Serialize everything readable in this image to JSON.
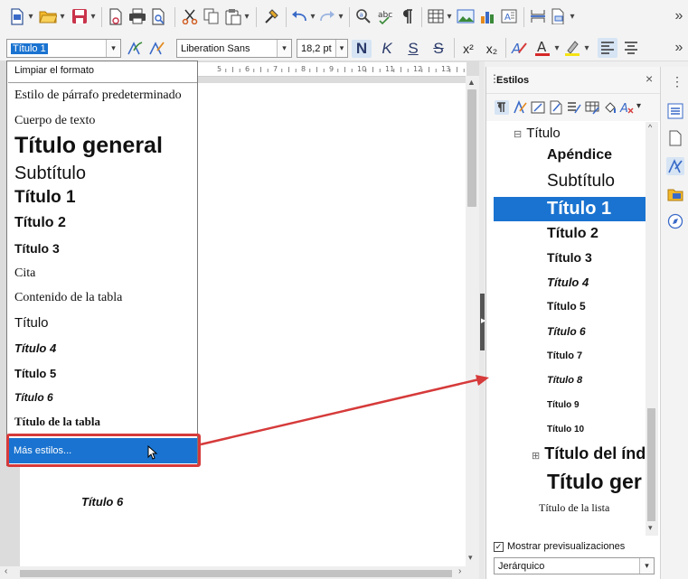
{
  "toolbar_format": {
    "paragraph_style": "Título 1",
    "font_name": "Liberation Sans",
    "font_size": "18,2 pt",
    "bold": "N",
    "italic": "K",
    "underline": "S",
    "strike": "S",
    "superscript": "x²",
    "subscript": "x₂",
    "overflow": "»"
  },
  "toolbar_main": {
    "overflow": "»"
  },
  "style_dropdown": {
    "items": [
      "Limpiar el formato",
      "Estilo de párrafo predeterminado",
      "Cuerpo de texto",
      "Título general",
      "Subtítulo",
      "Título 1",
      "Título 2",
      "Título 3",
      "Cita",
      "Contenido de la tabla",
      "Título",
      "Título 4",
      "Título 5",
      "Título 6",
      "Título de la tabla"
    ],
    "more": "Más estilos..."
  },
  "ruler_ticks": [
    "5",
    "6",
    "7",
    "8",
    "9",
    "10",
    "11",
    "12",
    "13"
  ],
  "document": {
    "body_text": "Título 6"
  },
  "styles_panel": {
    "title": "Estilos",
    "close": "×",
    "menu": "⋮",
    "tree": [
      "Título",
      "Apéndice",
      "Subtítulo",
      "Título 1",
      "Título 2",
      "Título 3",
      "Título 4",
      "Título 5",
      "Título 6",
      "Título 7",
      "Título 8",
      "Título 9",
      "Título 10",
      "Título del índ",
      "Título ger",
      "Título de la lista"
    ],
    "show_previews_label": "Mostrar previsualizaciones",
    "filter_value": "Jerárquico"
  },
  "colors": {
    "selection": "#1a73d0",
    "callout": "#d63a3a"
  }
}
